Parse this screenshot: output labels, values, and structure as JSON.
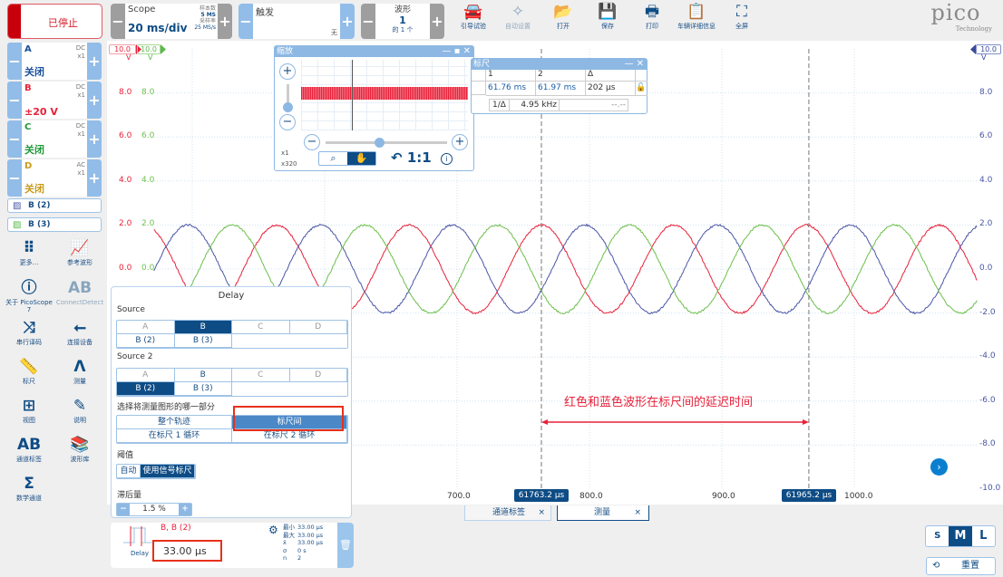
{
  "toolbar": {
    "status": "已停止",
    "scope": {
      "title": "Scope",
      "timebase": "20 ms/div",
      "samples_label": "样本数",
      "samples": "5 MS",
      "rate_label": "采样率",
      "rate": "25 MS/s"
    },
    "trigger": {
      "title": "触发",
      "mode": "无"
    },
    "waveform": {
      "title": "波形",
      "current": "1",
      "total": "的 1 个"
    },
    "buttons": [
      {
        "label": "引导试验",
        "icon": "car-icon"
      },
      {
        "label": "自动设置",
        "icon": "magic-wand-icon"
      },
      {
        "label": "打开",
        "icon": "folder-icon"
      },
      {
        "label": "保存",
        "icon": "save-icon"
      },
      {
        "label": "打印",
        "icon": "printer-icon"
      },
      {
        "label": "车辆详细信息",
        "icon": "clipboard-icon"
      },
      {
        "label": "全屏",
        "icon": "fullscreen-icon"
      }
    ],
    "logo": {
      "name": "pico",
      "sub": "Technology"
    }
  },
  "channels": [
    {
      "name": "A",
      "coupling": "DC",
      "probe": "x1",
      "state": "关闭",
      "color": "#1a4f9c"
    },
    {
      "name": "B",
      "coupling": "DC",
      "probe": "x1",
      "state": "±20 V",
      "color": "#e8213a"
    },
    {
      "name": "C",
      "coupling": "DC",
      "probe": "x1",
      "state": "关闭",
      "color": "#1f9a3a"
    },
    {
      "name": "D",
      "coupling": "AC",
      "probe": "x1",
      "state": "关闭",
      "color": "#c99a1a"
    }
  ],
  "math_channels": [
    {
      "label": "B (2)"
    },
    {
      "label": "B (3)"
    }
  ],
  "tools": [
    {
      "label": "更多...",
      "icon": "grid-dots-icon"
    },
    {
      "label": "参考波形",
      "icon": "reference-waveform-icon"
    },
    {
      "label": "关于 PicoScope 7",
      "icon": "info-icon"
    },
    {
      "label": "ConnectDetect",
      "icon": "connect-detect-icon"
    },
    {
      "label": "串行译码",
      "icon": "serial-decode-icon"
    },
    {
      "label": "连接设备",
      "icon": "usb-icon"
    },
    {
      "label": "标尺",
      "icon": "ruler-icon"
    },
    {
      "label": "测量",
      "icon": "measure-icon"
    },
    {
      "label": "视图",
      "icon": "view-grid-icon"
    },
    {
      "label": "说明",
      "icon": "notes-icon"
    },
    {
      "label": "通道标签",
      "icon": "channel-labels-icon"
    },
    {
      "label": "波形库",
      "icon": "waveform-library-icon"
    },
    {
      "label": "数学通道",
      "icon": "sigma-icon"
    }
  ],
  "zoom_window": {
    "title": "缩放",
    "zoom_x": "x1",
    "zoom_y": "x320",
    "reset": "1:1"
  },
  "ruler_window": {
    "title": "标尺",
    "headers": [
      "1",
      "2",
      "Δ"
    ],
    "values": [
      "61.76 ms",
      "61.97 ms",
      "202 µs"
    ],
    "inv_label": "1/Δ",
    "inv_value": "4.95 kHz",
    "extra": "--.--"
  },
  "delay_panel": {
    "title": "Delay",
    "source_label": "Source",
    "source_options": [
      "A",
      "B",
      "C",
      "D",
      "B (2)",
      "B (3)"
    ],
    "source_selected": "B",
    "source2_label": "Source 2",
    "source2_options": [
      "A",
      "B",
      "C",
      "D",
      "B (2)",
      "B (3)"
    ],
    "source2_selected": "B (2)",
    "section_label": "选择将测量图形的哪一部分",
    "section_options": [
      "整个轨迹",
      "标尺间",
      "在标尺 1 循环",
      "在标尺 2 循环"
    ],
    "section_selected": "标尺间",
    "threshold_label": "阈值",
    "threshold_options": [
      "自动",
      "使用信号标尺"
    ],
    "threshold_selected": "使用信号标尺",
    "hysteresis_label": "滞后量",
    "hysteresis_value": "1.5 %"
  },
  "measurement": {
    "name": "Delay",
    "sources": "B, B (2)",
    "value": "33.00 µs",
    "stats": [
      [
        "最小",
        "33.00 µs"
      ],
      [
        "最大",
        "33.00 µs"
      ],
      [
        "x̄",
        "33.00 µs"
      ],
      [
        "σ",
        "0 s"
      ],
      [
        "n",
        "2"
      ]
    ]
  },
  "tabs": [
    {
      "label": "通道标签"
    },
    {
      "label": "测量"
    }
  ],
  "size_buttons": [
    "S",
    "M",
    "L"
  ],
  "size_selected": "M",
  "reset_label": "重置",
  "annotation": "红色和蓝色波形在标尺间的延迟时间",
  "colors": {
    "accent": "#0e4c85",
    "red": "#e8213a",
    "blue": "#4a56a6",
    "green": "#6cbf4c"
  },
  "chart_data": {
    "type": "line",
    "x_ticks": [
      "700.0",
      "800.0",
      "900.0",
      "1000.0"
    ],
    "xlim": [
      438,
      1093
    ],
    "ylim": [
      -10,
      10
    ],
    "left_axis_red": {
      "range_label": "10.0",
      "unit": "V",
      "ticks": [
        "8.0",
        "6.0",
        "4.0",
        "2.0",
        "0.0"
      ]
    },
    "left_axis_green": {
      "range_label": "10.0",
      "unit": "V",
      "ticks": [
        "8.0",
        "6.0",
        "4.0",
        "2.0",
        "0.0"
      ]
    },
    "right_axis": {
      "range_label": "10.0",
      "unit": "V",
      "ticks": [
        "8.0",
        "6.0",
        "4.0",
        "2.0",
        "0.0",
        "-2.0",
        "-4.0",
        "-6.0",
        "-8.0",
        "-10.0"
      ]
    },
    "grid": true,
    "series": [
      {
        "name": "B",
        "color": "#e8213a",
        "amplitude": 2,
        "period": 100,
        "peak_at": 763.7
      },
      {
        "name": "B (2)",
        "color": "#4a56a6",
        "amplitude": 2,
        "period": 100,
        "peak_at": 796.7
      },
      {
        "name": "B (3)",
        "color": "#6cbf4c",
        "amplitude": 2,
        "period": 100,
        "peak_at": 730.3
      }
    ],
    "x_range_traces": [
      471,
      1093
    ],
    "cursors": [
      {
        "label": "61763.2 µs",
        "x": 763.7
      },
      {
        "label": "61965.2 µs",
        "x": 965.7
      }
    ]
  }
}
